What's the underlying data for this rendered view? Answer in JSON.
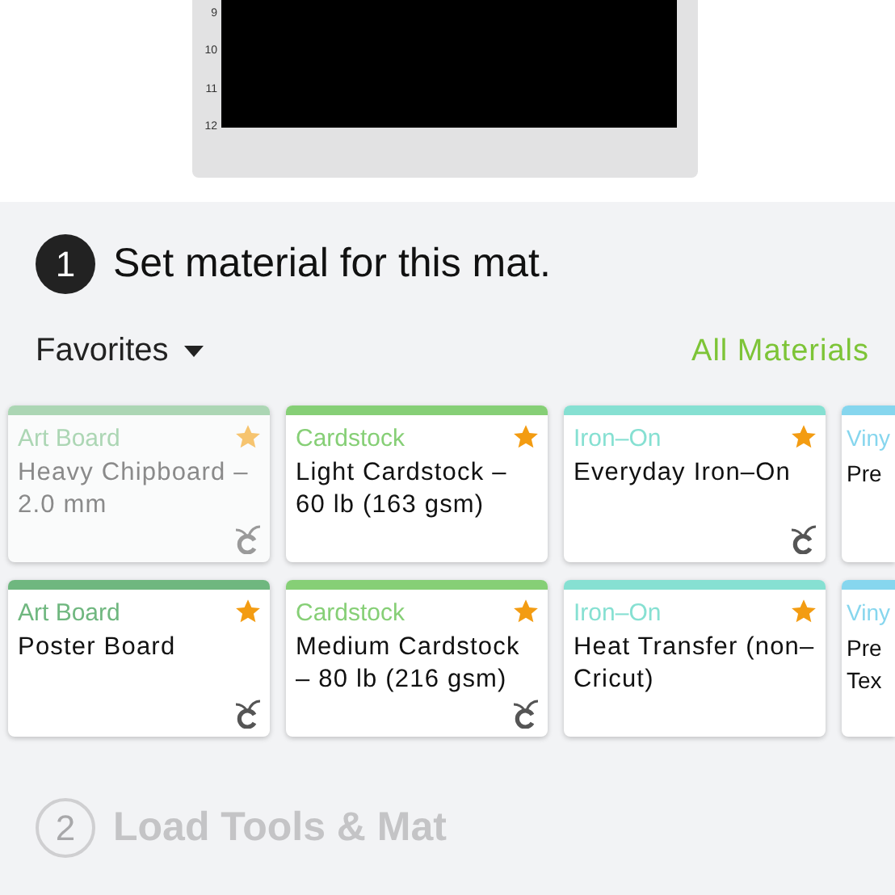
{
  "mat_preview": {
    "ruler": [
      "9",
      "10",
      "11",
      "12"
    ]
  },
  "step1": {
    "number": "1",
    "title": "Set material for this mat.",
    "active": true
  },
  "filter": {
    "label": "Favorites",
    "link": "All Materials"
  },
  "material_rows": [
    [
      {
        "category": "Art Board",
        "name": "Heavy Chipboard – 2.0 mm",
        "color": "#acd6b4",
        "favorite": true,
        "cricut": true,
        "dimmed": true
      },
      {
        "category": "Cardstock",
        "name": "Light Cardstock – 60 lb (163 gsm)",
        "color": "#86cf76",
        "favorite": true,
        "cricut": false,
        "dimmed": false
      },
      {
        "category": "Iron–On",
        "name": "Everyday Iron–On",
        "color": "#86e0d2",
        "favorite": true,
        "cricut": true,
        "dimmed": false
      },
      {
        "category": "Viny",
        "name": "Pre",
        "color": "#86d6ee",
        "dimmed": false
      }
    ],
    [
      {
        "category": "Art Board",
        "name": "Poster Board",
        "color": "#6fb77f",
        "favorite": true,
        "cricut": true,
        "dimmed": false
      },
      {
        "category": "Cardstock",
        "name": "Medium Cardstock – 80 lb (216 gsm)",
        "color": "#86cf76",
        "favorite": true,
        "cricut": true,
        "dimmed": false
      },
      {
        "category": "Iron–On",
        "name": "Heat Transfer (non–Cricut)",
        "color": "#86e0d2",
        "favorite": true,
        "cricut": false,
        "dimmed": false
      },
      {
        "category": "Viny",
        "name": "Pre Tex",
        "color": "#86d6ee",
        "dimmed": false
      }
    ]
  ],
  "step2": {
    "number": "2",
    "title": "Load Tools & Mat",
    "active": false
  }
}
